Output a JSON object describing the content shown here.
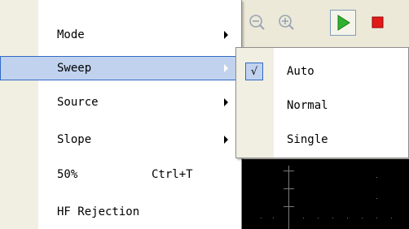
{
  "menu": {
    "items": [
      {
        "label": "Mode",
        "shortcut": "",
        "submenu": true
      },
      {
        "label": "Sweep",
        "shortcut": "",
        "submenu": true,
        "highlighted": true
      },
      {
        "label": "Source",
        "shortcut": "",
        "submenu": true
      },
      {
        "label": "Slope",
        "shortcut": "",
        "submenu": true
      },
      {
        "label": "50%",
        "shortcut": "Ctrl+T",
        "submenu": false
      },
      {
        "label": "HF Rejection",
        "shortcut": "",
        "submenu": false
      }
    ]
  },
  "submenu": {
    "items": [
      {
        "label": "Auto",
        "checked": true
      },
      {
        "label": "Normal",
        "checked": false
      },
      {
        "label": "Single",
        "checked": false
      }
    ],
    "check_glyph": "√"
  },
  "toolbar": {
    "icons": [
      "zoom-out-icon",
      "zoom-in-icon",
      "run-icon",
      "stop-icon"
    ]
  },
  "colors": {
    "highlight": "#c1d2ee",
    "highlight_border": "#316ac5",
    "gutter": "#f1efe2",
    "run": "#2fb12f",
    "stop": "#e31a1a"
  }
}
